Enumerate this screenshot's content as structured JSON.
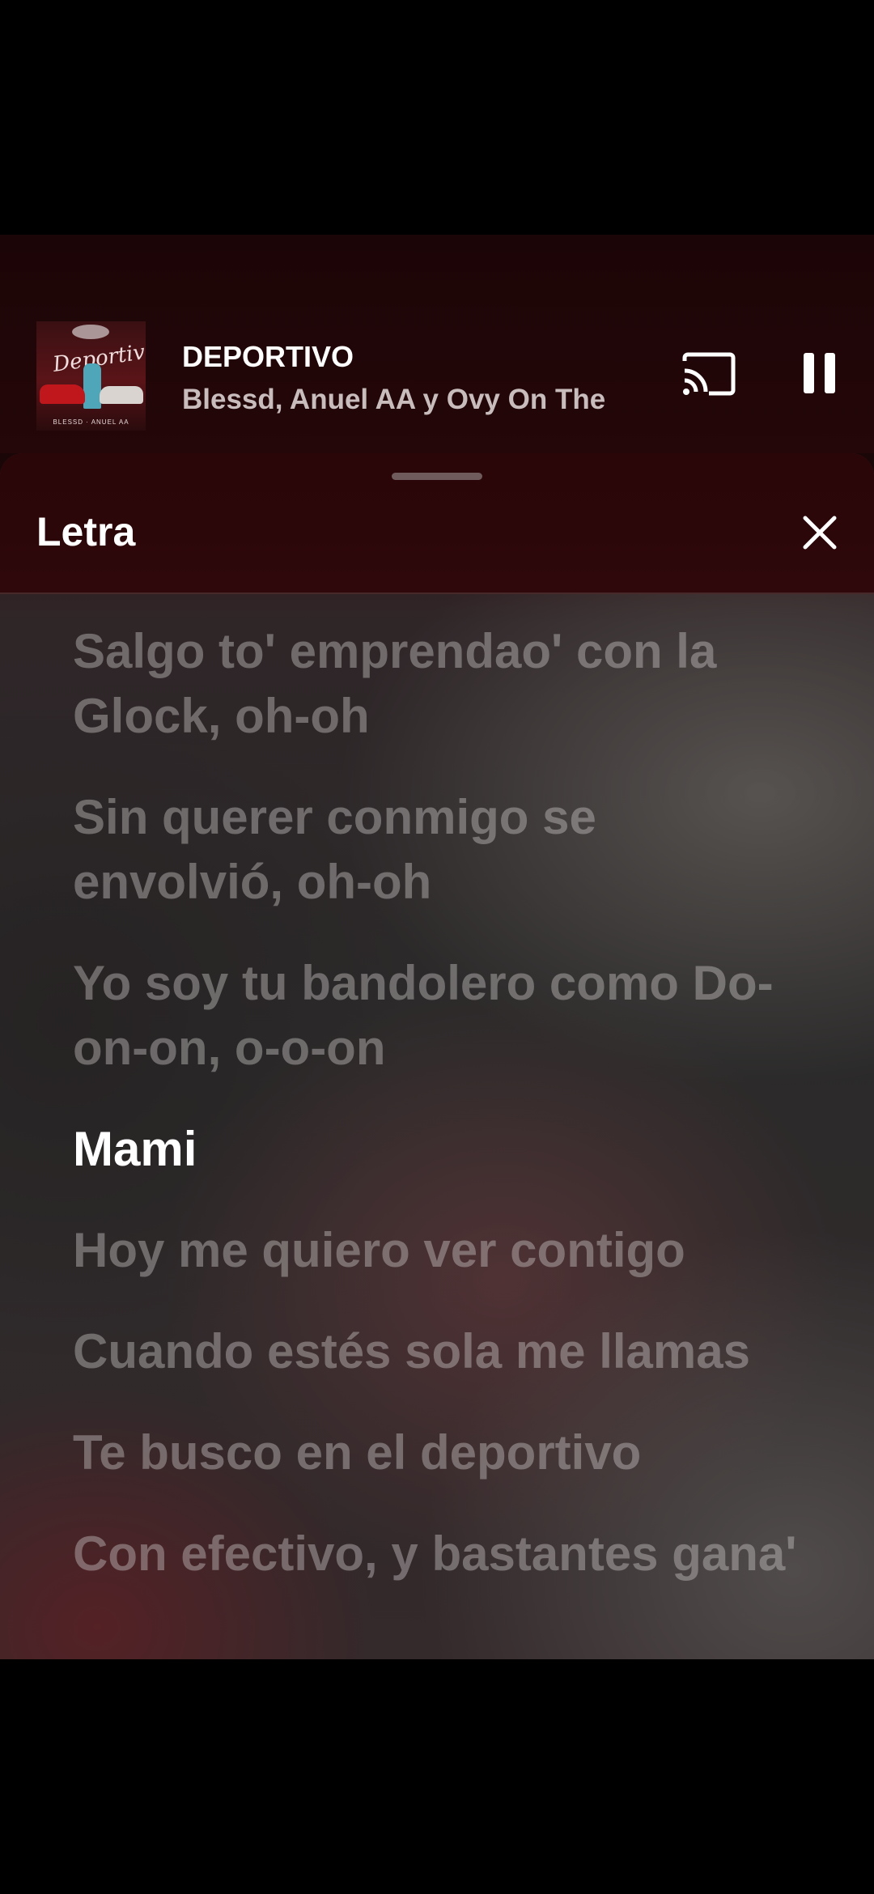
{
  "now_playing": {
    "title": "DEPORTIVO",
    "artists": "Blessd, Anuel AA y Ovy On The",
    "album_art": {
      "title_text": "Deportivo",
      "footer_text": "BLESSD · ANUEL AA"
    },
    "state": "playing"
  },
  "icons": {
    "cast": "cast-icon",
    "pause": "pause-icon",
    "close": "close-icon"
  },
  "lyrics_sheet": {
    "title": "Letra",
    "lines": [
      "Salgo to' emprendao' con la Glock, oh-oh",
      "Sin querer conmigo se envolvió, oh-oh",
      "Yo soy tu bandolero como Do-on-on, o-o-on",
      "Mami",
      "Hoy me quiero ver contigo",
      "Cuando estés sola me llamas",
      "Te busco en el deportivo",
      "Con efectivo, y bastantes gana'"
    ],
    "active_line_index": 3
  },
  "colors": {
    "background": "#000000",
    "mini_player_bg": "#1c0507",
    "sheet_header_bg": "#2a0608",
    "active_lyric": "#ffffff",
    "inactive_lyric": "#cdc8c8"
  }
}
